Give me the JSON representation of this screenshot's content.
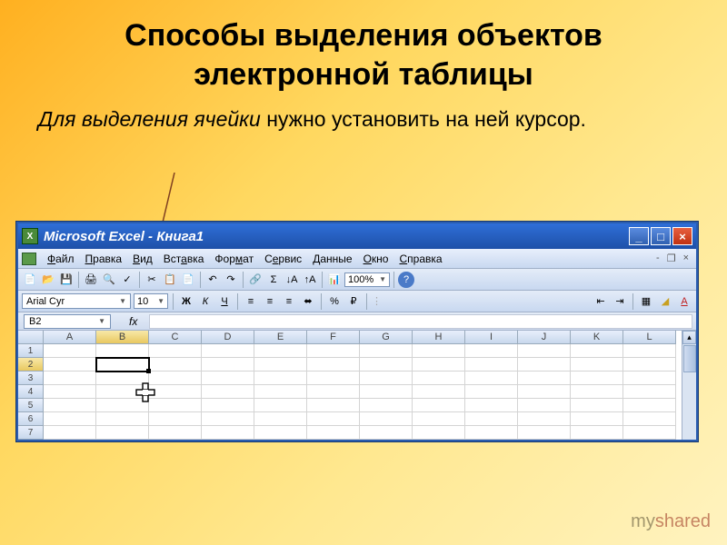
{
  "slide": {
    "title": "Способы выделения объектов электронной таблицы",
    "body_italic": "Для выделения ячейки ",
    "body_rest": "нужно установить на ней курсор."
  },
  "excel": {
    "titlebar": "Microsoft Excel - Книга1",
    "menu": {
      "file": "Файл",
      "edit": "Правка",
      "view": "Вид",
      "insert": "Вставка",
      "format": "Формат",
      "tools": "Сервис",
      "data": "Данные",
      "window": "Окно",
      "help": "Справка"
    },
    "toolbar": {
      "zoom": "100%"
    },
    "formatbar": {
      "font": "Arial Cyr",
      "size": "10",
      "bold": "Ж",
      "italic": "К",
      "underline": "Ч",
      "percent": "%"
    },
    "namebox": "B2",
    "fx": "fx",
    "columns": [
      "A",
      "B",
      "C",
      "D",
      "E",
      "F",
      "G",
      "H",
      "I",
      "J",
      "K",
      "L"
    ],
    "rows": [
      "1",
      "2",
      "3",
      "4",
      "5",
      "6",
      "7"
    ],
    "active_col": "B",
    "active_row": "2"
  },
  "watermark": "myshared"
}
